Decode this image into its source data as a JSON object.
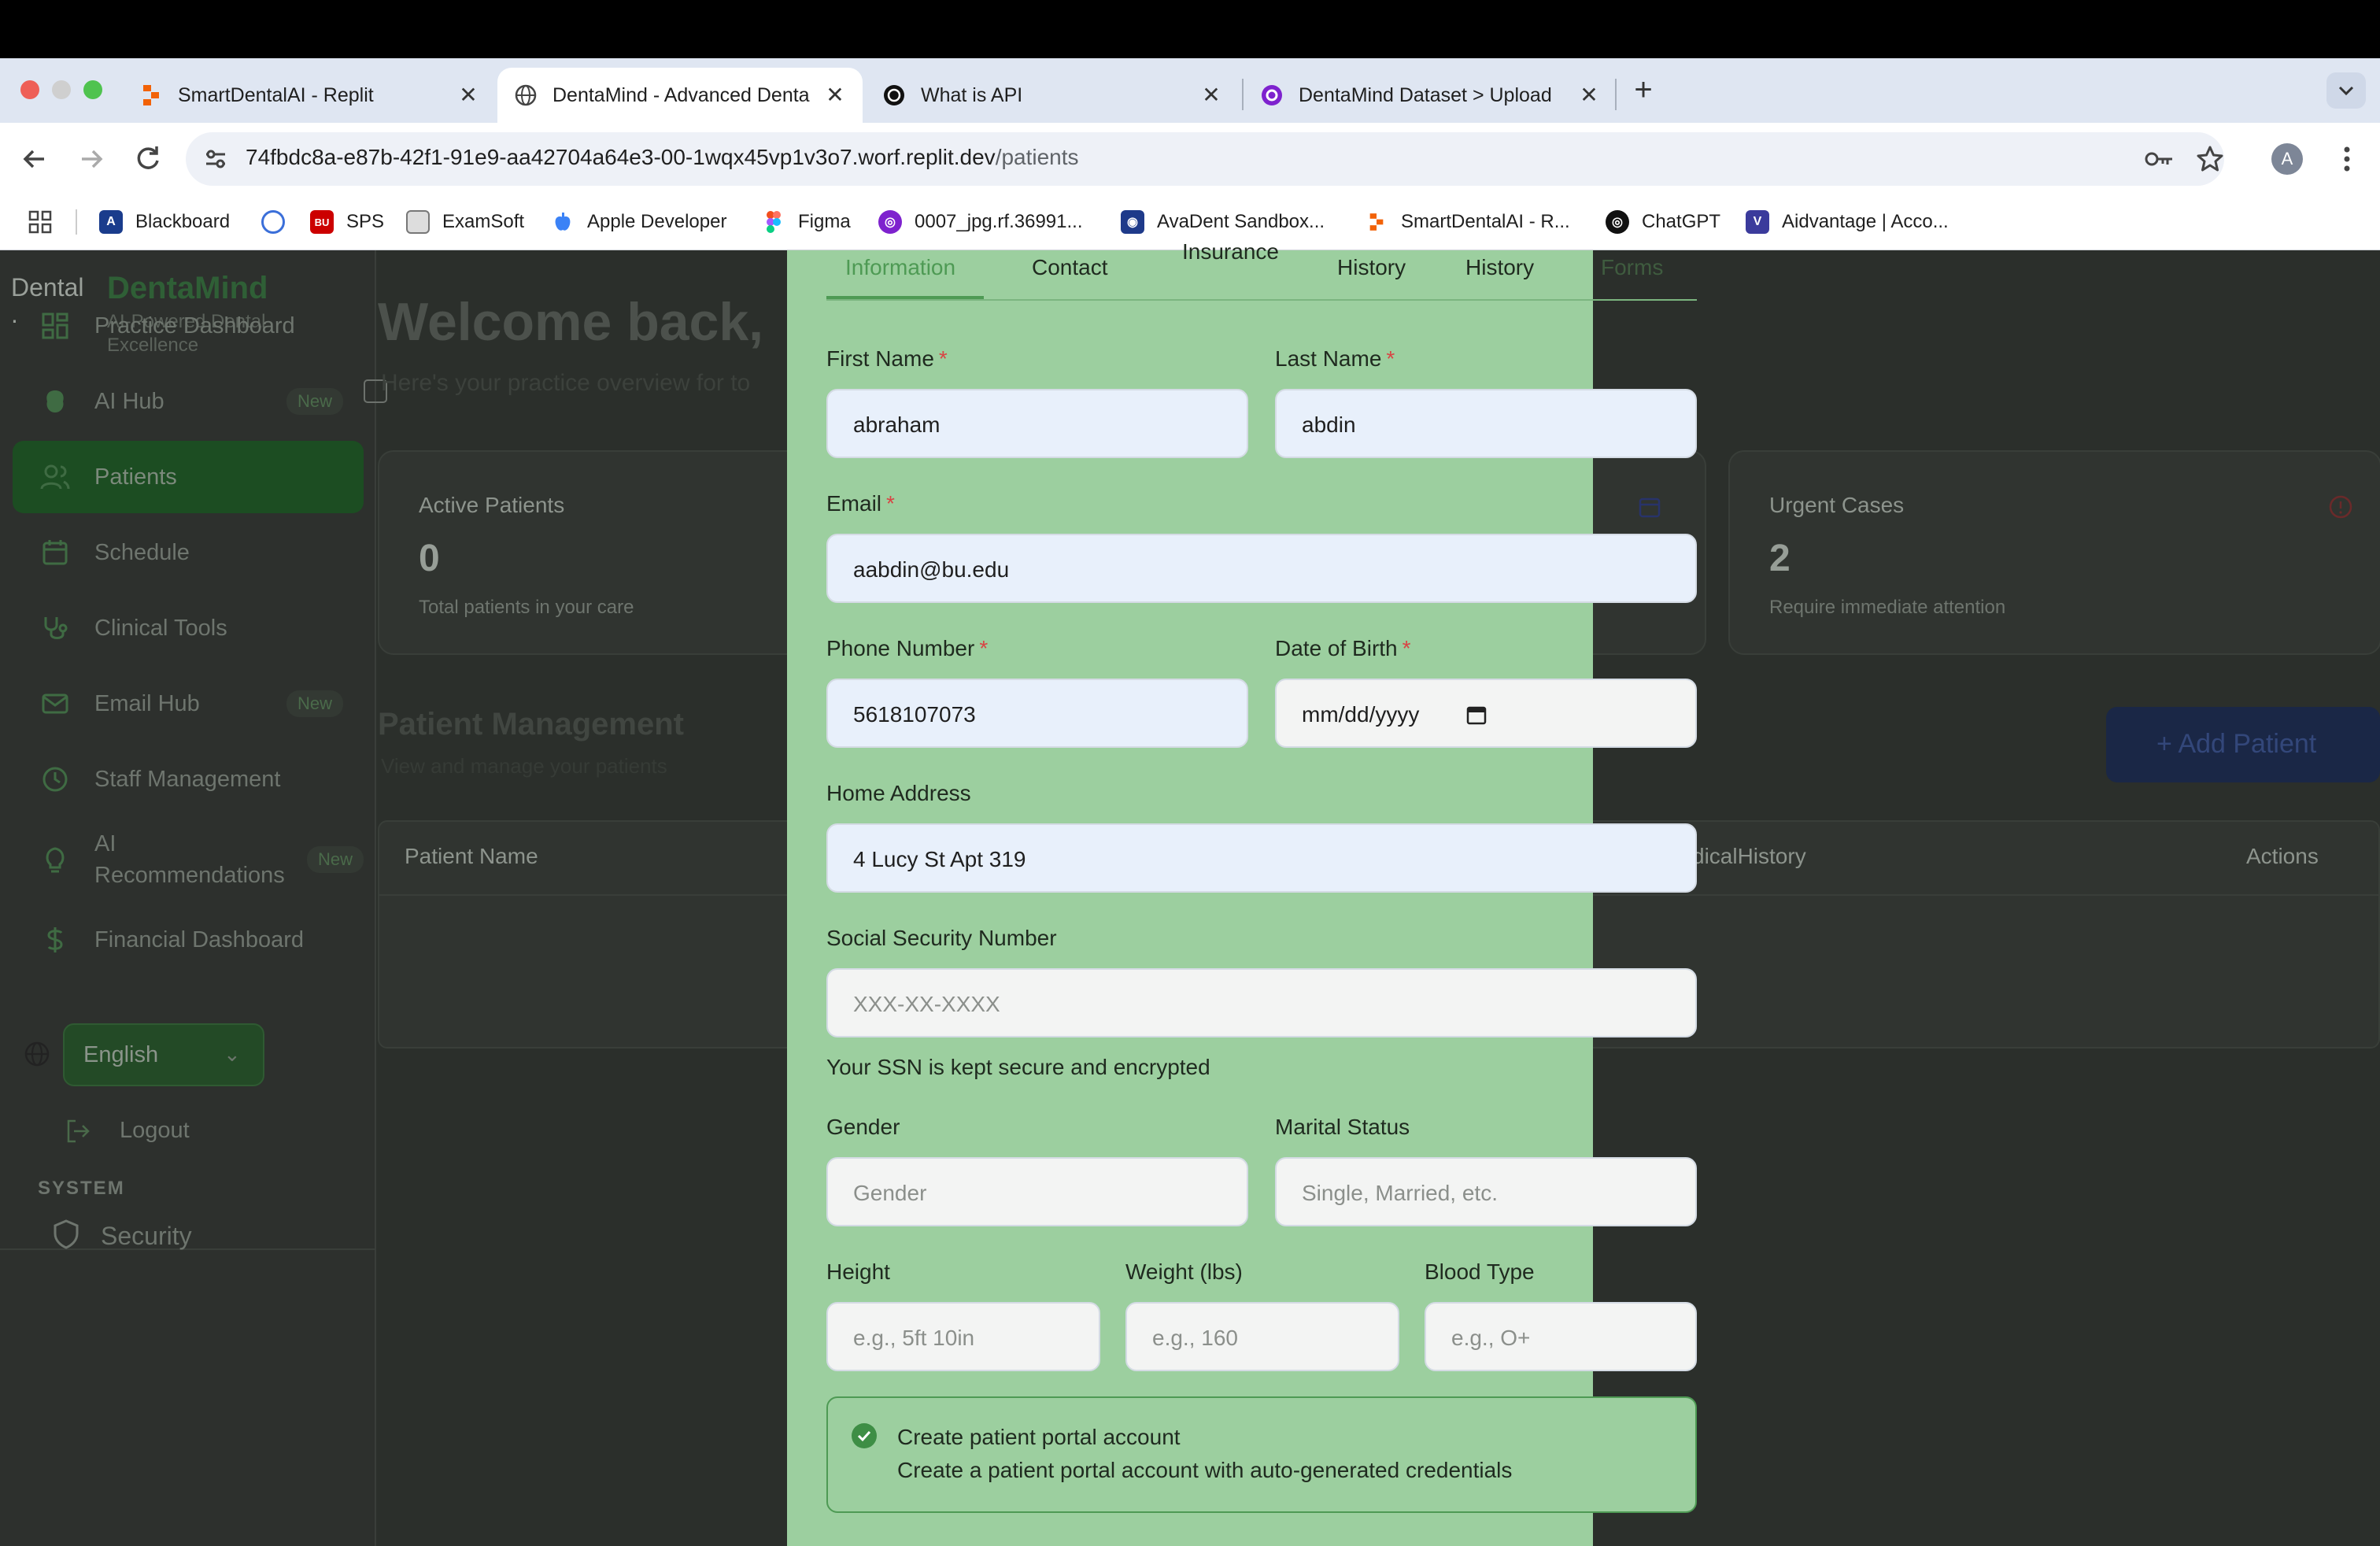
{
  "browser": {
    "tabs": [
      {
        "title": "SmartDentalAI - Replit",
        "favicon": "replit-icon"
      },
      {
        "title": "DentaMind - Advanced Denta",
        "favicon": "globe-icon"
      },
      {
        "title": "What is API",
        "favicon": "chatgpt-icon"
      },
      {
        "title": "DentaMind Dataset > Upload",
        "favicon": "roboflow-icon"
      }
    ],
    "close_glyph": "✕",
    "new_tab_glyph": "+",
    "url_host": "74fbdc8a-e87b-42f1-91e9-aa42704a64e3-00-1wqx45vp1v3o7.worf.replit.dev",
    "url_path": "/patients",
    "profile_initial": "A",
    "bookmarks": [
      {
        "label": "Blackboard",
        "icon": "blackboard-icon",
        "color": "#1a3c8c"
      },
      {
        "label": "",
        "icon": "q-icon",
        "color": "#3b6fd9"
      },
      {
        "label": "SPS",
        "icon": "bu-icon",
        "color": "#cc0000"
      },
      {
        "label": "ExamSoft",
        "icon": "examsoft-icon",
        "color": "#777777"
      },
      {
        "label": "Apple Developer",
        "icon": "apple-icon",
        "color": "#3b82f6"
      },
      {
        "label": "Figma",
        "icon": "figma-icon",
        "color": "#f24e1e"
      },
      {
        "label": "0007_jpg.rf.36991...",
        "icon": "roboflow-icon",
        "color": "#7e22ce"
      },
      {
        "label": "AvaDent Sandbox...",
        "icon": "avadent-icon",
        "color": "#1e3a8a"
      },
      {
        "label": "SmartDentalAI - R...",
        "icon": "replit-icon",
        "color": "#f26207"
      },
      {
        "label": "ChatGPT",
        "icon": "chatgpt-icon",
        "color": "#111111"
      },
      {
        "label": "Aidvantage | Acco...",
        "icon": "aidvantage-icon",
        "color": "#3b3b9c"
      }
    ]
  },
  "sidebar": {
    "logo_alt": "Dental\n.",
    "brand": "DentaMind",
    "tagline": "AI-Powered Dental Excellence",
    "items": [
      {
        "label": "Practice Dashboard",
        "icon": "dashboard-icon",
        "badge": ""
      },
      {
        "label": "AI Hub",
        "icon": "brain-icon",
        "badge": "New"
      },
      {
        "label": "Patients",
        "icon": "users-icon",
        "badge": ""
      },
      {
        "label": "Schedule",
        "icon": "calendar-icon",
        "badge": ""
      },
      {
        "label": "Clinical Tools",
        "icon": "stethoscope-icon",
        "badge": ""
      },
      {
        "label": "Email Hub",
        "icon": "mail-icon",
        "badge": "New"
      },
      {
        "label": "Staff Management",
        "icon": "clock-icon",
        "badge": ""
      },
      {
        "label": "AI\nRecommendations",
        "icon": "lightbulb-icon",
        "badge": "New"
      },
      {
        "label": "Financial Dashboard",
        "icon": "dollar-icon",
        "badge": ""
      }
    ],
    "language": "English",
    "logout": "Logout",
    "system_heading": "SYSTEM",
    "security": "Security"
  },
  "main": {
    "welcome": "Welcome back,",
    "welcome_sub": "Here's your practice overview for to",
    "stats": [
      {
        "title": "Active Patients",
        "value": "0",
        "desc": "Total patients in your care"
      },
      {
        "title": "Urgent Cases",
        "value": "2",
        "desc": "Require immediate attention"
      }
    ],
    "pm_title": "Patient Management",
    "pm_sub": "View and manage your patients",
    "add_patient": "Add Patient",
    "table_headers": {
      "name": "Patient Name",
      "history": "dicalHistory",
      "actions": "Actions"
    }
  },
  "modal": {
    "tabs": [
      "Information",
      "Contact",
      "Insurance",
      "History",
      "History",
      "Forms"
    ],
    "first_name": {
      "label": "First Name",
      "value": "abraham"
    },
    "last_name": {
      "label": "Last Name",
      "value": "abdin"
    },
    "email": {
      "label": "Email",
      "value": "aabdin@bu.edu"
    },
    "phone": {
      "label": "Phone Number",
      "value": "5618107073"
    },
    "dob": {
      "label": "Date of Birth",
      "placeholder": "mm/dd/yyyy"
    },
    "address": {
      "label": "Home Address",
      "value": "4 Lucy St Apt 319"
    },
    "ssn": {
      "label": "Social Security Number",
      "placeholder": "XXX-XX-XXXX",
      "hint": "Your SSN is kept secure and encrypted"
    },
    "gender": {
      "label": "Gender",
      "placeholder": "Gender"
    },
    "marital": {
      "label": "Marital Status",
      "placeholder": "Single, Married, etc."
    },
    "height": {
      "label": "Height",
      "placeholder": "e.g., 5ft 10in"
    },
    "weight": {
      "label": "Weight (lbs)",
      "placeholder": "e.g., 160"
    },
    "blood": {
      "label": "Blood Type",
      "placeholder": "e.g., O+"
    },
    "portal": {
      "title": "Create patient portal account",
      "desc": "Create a patient portal account with auto-generated credentials",
      "checked": true
    },
    "required_mark": "*"
  }
}
